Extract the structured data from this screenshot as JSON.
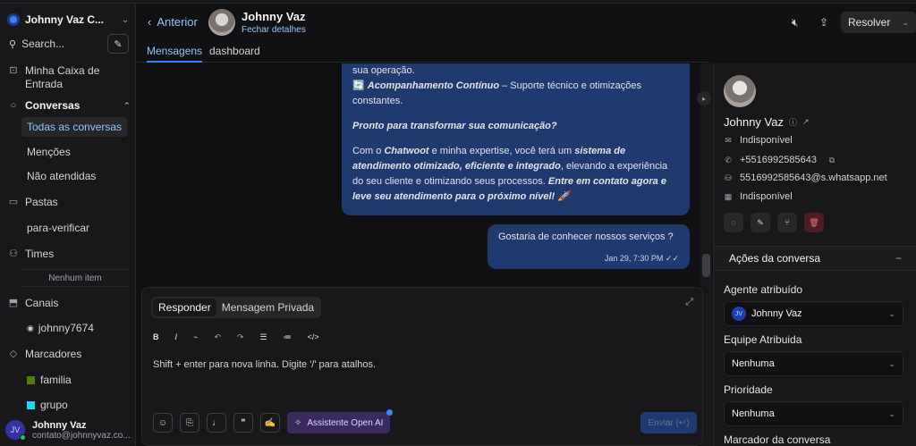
{
  "workspace": {
    "name": "Johnny Vaz C..."
  },
  "search": {
    "placeholder": "Search..."
  },
  "nav": {
    "inbox": "Minha Caixa de Entrada",
    "conversations": "Conversas",
    "conversation_items": [
      "Todas as conversas",
      "Menções",
      "Não atendidas"
    ],
    "folders": "Pastas",
    "folder_items": [
      "para-verificar"
    ],
    "teams": "Times",
    "teams_empty": "Nenhum item",
    "channels": "Canais",
    "channel_items": [
      "johnny7674"
    ],
    "labels": "Marcadores",
    "label_items": [
      {
        "name": "familia",
        "color": "#4d7c0f"
      },
      {
        "name": "grupo",
        "color": "#22d3ee"
      }
    ]
  },
  "current_user": {
    "initials": "JV",
    "name": "Johnny Vaz",
    "email": "contato@johnnyvaz.co..."
  },
  "header": {
    "back_label": "Anterior",
    "contact_name": "Johnny Vaz",
    "subtitle": "Fechar detalhes",
    "resolve_label": "Resolver"
  },
  "tabs": [
    "Mensagens",
    "dashboard"
  ],
  "messages": {
    "bubble1": {
      "p1": "sua operação.",
      "p2_emoji": "🔄",
      "p2_bold": "Acompanhamento Contínuo",
      "p2_rest": " – Suporte técnico e otimizações constantes.",
      "p3": "Pronto para transformar sua comunicação?",
      "p4_a": "Com o ",
      "p4_b": "Chatwoot",
      "p4_c": " e minha expertise, você terá um ",
      "p4_d": "sistema de atendimento otimizado, eficiente e integrado",
      "p4_e": ", elevando a experiência do seu cliente e otimizando seus processos. ",
      "p4_f": "Entre em contato agora e leve seu atendimento para o próximo nível! 🚀"
    },
    "bubble2": {
      "text": "Gostaria de conhecer nossos serviços ?",
      "time": "Jan 29, 7:30 PM"
    }
  },
  "composer": {
    "mode_reply": "Responder",
    "mode_private": "Mensagem Privada",
    "placeholder": "Shift + enter para nova linha. Digite '/' para atalhos.",
    "ai_label": "Assistente Open AI",
    "send_label": "Enviar (↵)"
  },
  "contact": {
    "name": "Johnny Vaz",
    "availability": "Indisponível",
    "phone": "+5516992585643",
    "whatsapp_id": "5516992585643@s.whatsapp.net",
    "status": "Indisponível"
  },
  "actions_panel": {
    "title": "Ações da conversa",
    "agent_label": "Agente atribuído",
    "agent_initials": "JV",
    "agent_value": "Johnny Vaz",
    "team_label": "Equipe Atribuida",
    "team_value": "Nenhuma",
    "priority_label": "Prioridade",
    "priority_value": "Nenhuma",
    "tag_label": "Marcador da conversa"
  }
}
